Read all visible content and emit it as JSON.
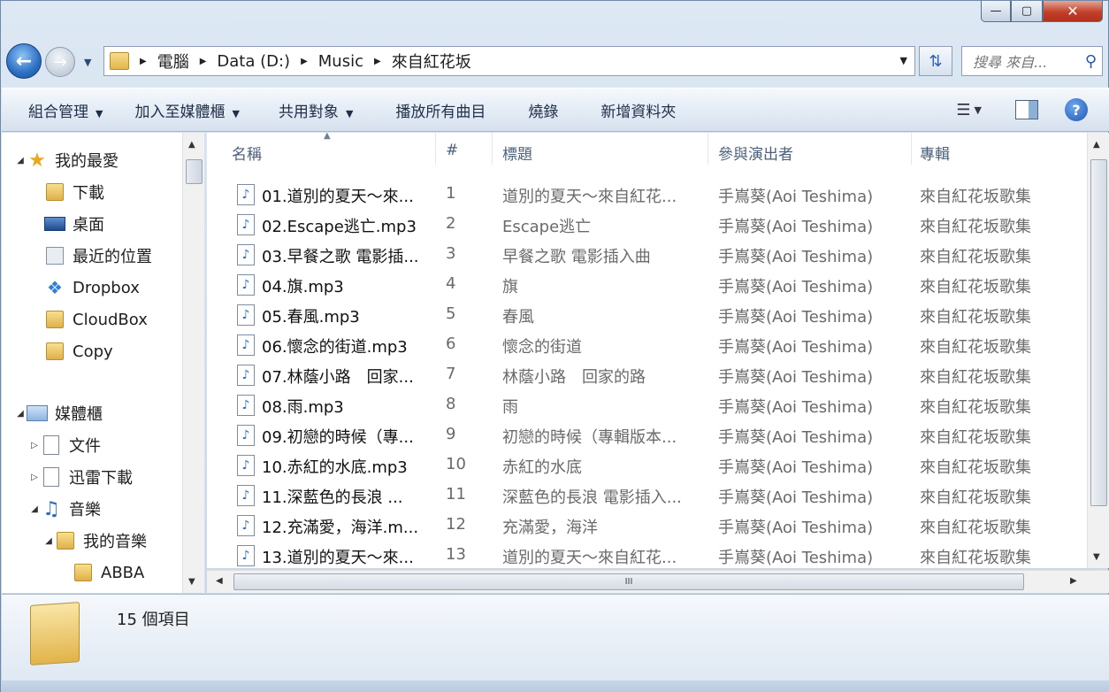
{
  "window": {
    "caption_buttons": {
      "minimize": "—",
      "maximize": "▢",
      "close": "✕"
    }
  },
  "address": {
    "crumbs": [
      "電腦",
      "Data (D:)",
      "Music",
      "來自紅花坂"
    ]
  },
  "search": {
    "placeholder": "搜尋 來自..."
  },
  "command_bar": {
    "organize": "組合管理",
    "add_to_library": "加入至媒體櫃",
    "share_with": "共用對象",
    "play_all": "播放所有曲目",
    "burn": "燒錄",
    "new_folder": "新增資料夾"
  },
  "nav": {
    "favorites": "我的最愛",
    "downloads": "下載",
    "desktop": "桌面",
    "recent": "最近的位置",
    "dropbox": "Dropbox",
    "cloudbox": "CloudBox",
    "copy": "Copy",
    "libraries": "媒體櫃",
    "documents": "文件",
    "thunder": "迅雷下載",
    "music": "音樂",
    "my_music": "我的音樂",
    "abba": "ABBA"
  },
  "columns": {
    "name": "名稱",
    "number": "#",
    "title": "標題",
    "artist": "參與演出者",
    "album": "專輯"
  },
  "files": [
    {
      "name": "01.道別的夏天～來...",
      "num": "1",
      "title": "道別的夏天～來自紅花...",
      "artist": "手嶌葵(Aoi Teshima)",
      "album": "來自紅花坂歌集"
    },
    {
      "name": "02.Escape逃亡.mp3",
      "num": "2",
      "title": "Escape逃亡",
      "artist": "手嶌葵(Aoi Teshima)",
      "album": "來自紅花坂歌集"
    },
    {
      "name": "03.早餐之歌 電影插...",
      "num": "3",
      "title": "早餐之歌 電影插入曲",
      "artist": "手嶌葵(Aoi Teshima)",
      "album": "來自紅花坂歌集"
    },
    {
      "name": "04.旗.mp3",
      "num": "4",
      "title": "旗",
      "artist": "手嶌葵(Aoi Teshima)",
      "album": "來自紅花坂歌集"
    },
    {
      "name": "05.春風.mp3",
      "num": "5",
      "title": "春風",
      "artist": "手嶌葵(Aoi Teshima)",
      "album": "來自紅花坂歌集"
    },
    {
      "name": "06.懷念的街道.mp3",
      "num": "6",
      "title": "懷念的街道",
      "artist": "手嶌葵(Aoi Teshima)",
      "album": "來自紅花坂歌集"
    },
    {
      "name": "07.林蔭小路　回家...",
      "num": "7",
      "title": "林蔭小路　回家的路",
      "artist": "手嶌葵(Aoi Teshima)",
      "album": "來自紅花坂歌集"
    },
    {
      "name": "08.雨.mp3",
      "num": "8",
      "title": "雨",
      "artist": "手嶌葵(Aoi Teshima)",
      "album": "來自紅花坂歌集"
    },
    {
      "name": "09.初戀的時候（專...",
      "num": "9",
      "title": "初戀的時候（專輯版本...",
      "artist": "手嶌葵(Aoi Teshima)",
      "album": "來自紅花坂歌集"
    },
    {
      "name": "10.赤紅的水底.mp3",
      "num": "10",
      "title": "赤紅的水底",
      "artist": "手嶌葵(Aoi Teshima)",
      "album": "來自紅花坂歌集"
    },
    {
      "name": "11.深藍色的長浪 ...",
      "num": "11",
      "title": "深藍色的長浪 電影插入...",
      "artist": "手嶌葵(Aoi Teshima)",
      "album": "來自紅花坂歌集"
    },
    {
      "name": "12.充滿愛，海洋.m...",
      "num": "12",
      "title": "充滿愛，海洋",
      "artist": "手嶌葵(Aoi Teshima)",
      "album": "來自紅花坂歌集"
    },
    {
      "name": "13.道別的夏天～來...",
      "num": "13",
      "title": "道別的夏天～來自紅花...",
      "artist": "手嶌葵(Aoi Teshima)",
      "album": "來自紅花坂歌集"
    }
  ],
  "hscroll_grip": "III",
  "status": {
    "item_count": "15 個項目"
  },
  "icons": {
    "back": "arrow-left-icon",
    "forward": "arrow-right-icon",
    "refresh": "refresh-icon",
    "search": "magnifier-icon",
    "music_file": "music-note-icon",
    "help": "question-icon"
  },
  "colors": {
    "accent": "#2b6fc3",
    "window_bg": "#cfdcec",
    "text_dim": "#6a6a6a"
  }
}
